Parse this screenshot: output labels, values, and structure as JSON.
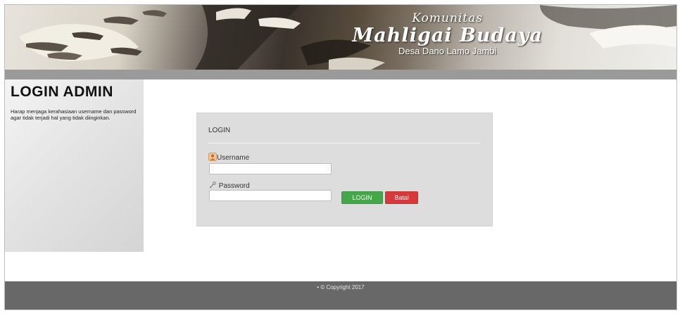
{
  "header": {
    "brand_line1": "Komunitas",
    "brand_line2": "Mahligai Budaya",
    "brand_line3": "Desa Dano Lamo Jambi"
  },
  "sidebar": {
    "title": "LOGIN ADMIN",
    "message": "Harap menjaga kerahasiaan username dan password agar tidak terjadi hal yang tidak diinginkan."
  },
  "login": {
    "heading": "LOGIN",
    "username_label": "Username",
    "username_value": "",
    "password_label": "Password",
    "password_value": "",
    "login_button": "LOGIN",
    "cancel_button": "Batal",
    "icons": {
      "username": "user-icon",
      "password": "key-icon"
    },
    "colors": {
      "login_button": "#45a64a",
      "cancel_button": "#d6393c"
    }
  },
  "footer": {
    "copyright": "• © Copyright 2017"
  }
}
